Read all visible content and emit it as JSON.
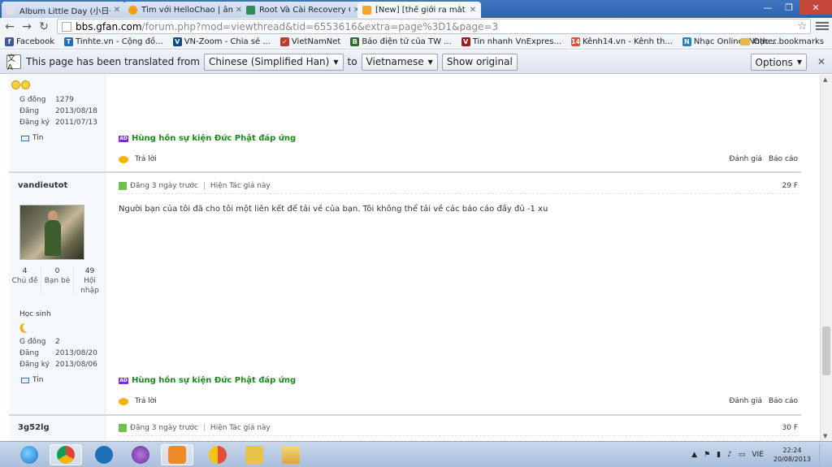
{
  "browser": {
    "tabs": [
      {
        "title": "Album Little Day (小日子) ...",
        "color": "#e0e0e0",
        "active": false
      },
      {
        "title": "Tìm với HelloChao | âm h...",
        "color": "#f39c12",
        "active": false
      },
      {
        "title": "Root Và Cài Recovery Cho...",
        "color": "#2e8b57",
        "active": false
      },
      {
        "title": "[New] [thế giới ra mắt] nh...",
        "color": "#f5a623",
        "active": true
      }
    ],
    "url_host": "bbs.gfan.com",
    "url_path": "/forum.php?mod=viewthread&tid=6553616&extra=page%3D1&page=3",
    "bookmarks": [
      {
        "label": "Facebook",
        "color": "#3b5998",
        "glyph": "f"
      },
      {
        "label": "Tinhte.vn - Cộng đồ...",
        "color": "#1a6fc4",
        "glyph": "T"
      },
      {
        "label": "VN-Zoom - Chia sẻ ...",
        "color": "#0a4a8a",
        "glyph": "V"
      },
      {
        "label": "VietNamNet",
        "color": "#c0392b",
        "glyph": "✓"
      },
      {
        "label": "Báo điện tử của TW ...",
        "color": "#2c6e2c",
        "glyph": "B"
      },
      {
        "label": "Tin nhanh VnExpres...",
        "color": "#9b1b1b",
        "glyph": "V"
      },
      {
        "label": "Kênh14.vn - Kênh th...",
        "color": "#e74c3c",
        "glyph": "14"
      },
      {
        "label": "Nhạc Online, Nhạc ...",
        "color": "#2980b9",
        "glyph": "N"
      }
    ],
    "other_bookmarks": "Other bookmarks"
  },
  "translate_bar": {
    "prefix": "This page has been translated from",
    "from_lang": "Chinese (Simplified Han)",
    "to_word": "to",
    "to_lang": "Vietnamese",
    "show_original": "Show original",
    "options": "Options"
  },
  "post1": {
    "stats": [
      {
        "k": "G đồng",
        "v": "1279"
      },
      {
        "k": "Đăng",
        "v": "2013/08/18"
      },
      {
        "k": "Đăng ký",
        "v": "2011/07/13"
      }
    ],
    "tin": "Tin",
    "signature": "Hùng hồn sự kiện Đức Phật đáp ứng",
    "reply": "Trả lời",
    "rate": "Đánh giá",
    "report": "Báo cáo"
  },
  "post2": {
    "username": "vandieutot",
    "counts": [
      {
        "n": "4",
        "label": "Chủ đề"
      },
      {
        "n": "0",
        "label": "Bạn bè"
      },
      {
        "n": "49",
        "label": "Hội nhập"
      }
    ],
    "rank": "Học sinh",
    "stats": [
      {
        "k": "G đồng",
        "v": "2"
      },
      {
        "k": "Đăng",
        "v": "2013/08/20"
      },
      {
        "k": "Đăng ký",
        "v": "2013/08/06"
      }
    ],
    "tin": "Tin",
    "posted": "Đăng 3 ngày trước",
    "show_author": "Hiện Tác giả này",
    "floor": "29 F",
    "body": "Người bạn của tôi đã cho tôi một liên kết để tải về của bạn. Tôi không thể tải về các báo cáo đầy đủ -1 xu",
    "signature": "Hùng hồn sự kiện Đức Phật đáp ứng",
    "reply": "Trả lời",
    "rate": "Đánh giá",
    "report": "Báo cáo"
  },
  "post3": {
    "username": "3g52lg",
    "posted": "Đăng 3 ngày trước",
    "show_author": "Hiện Tác giả này",
    "floor": "30 F"
  },
  "taskbar": {
    "lang": "VIE",
    "time": "22:24",
    "date": "20/08/2013"
  }
}
